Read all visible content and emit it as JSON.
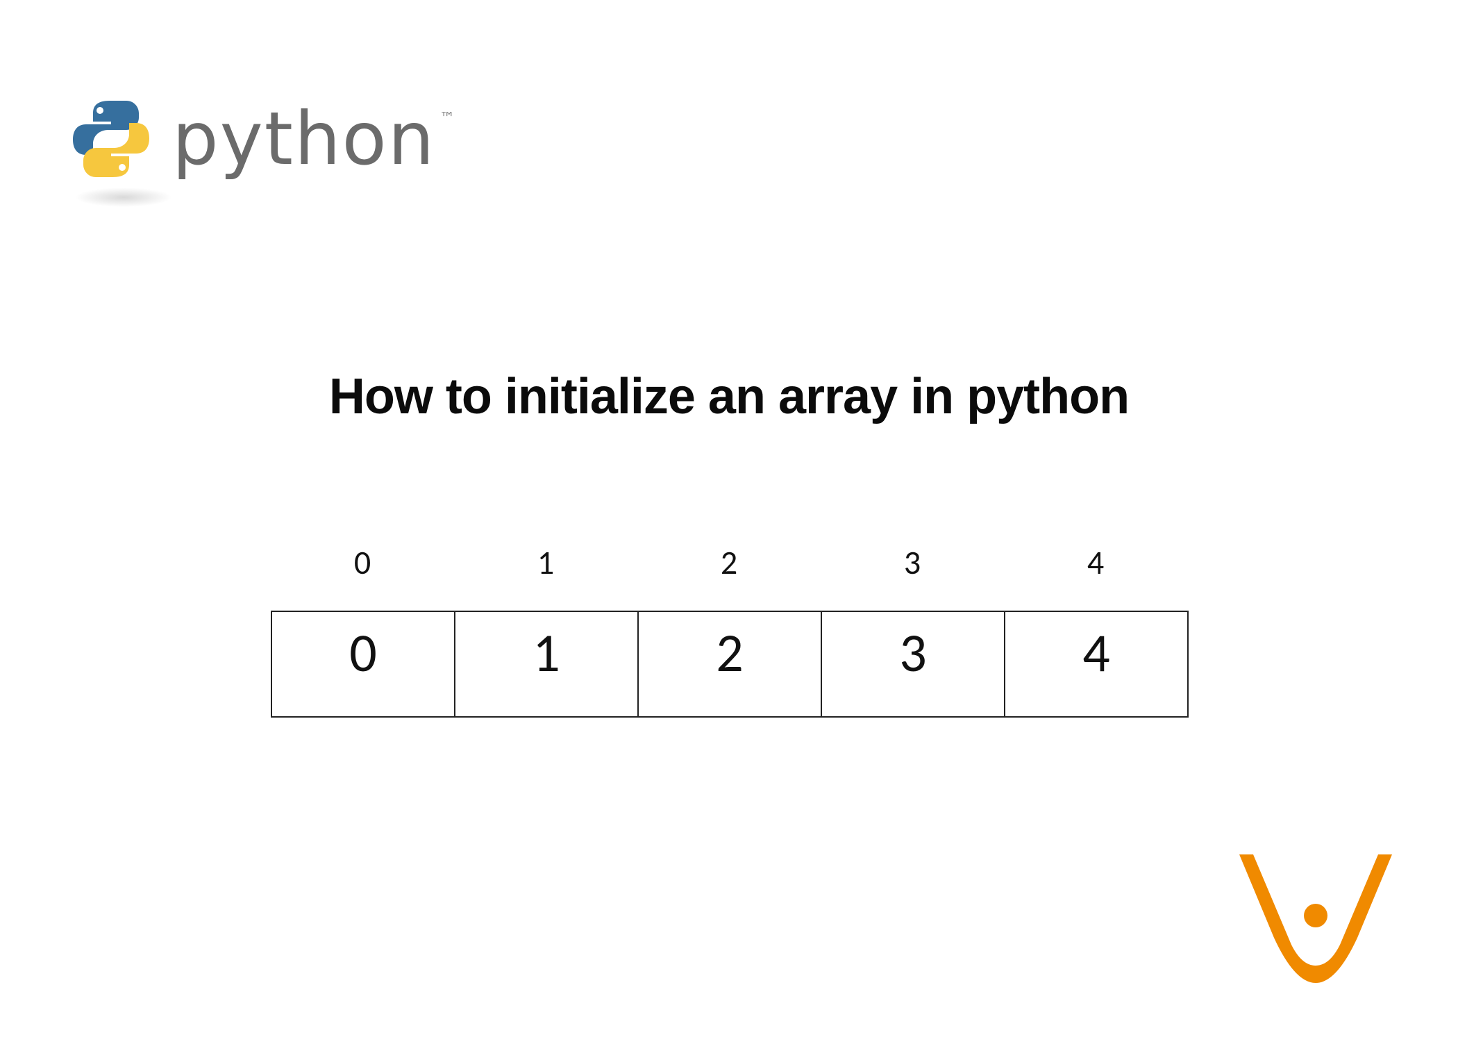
{
  "logo": {
    "word": "python",
    "trademark": "™"
  },
  "title": "How to initialize an array in python",
  "array": {
    "indices": [
      "0",
      "1",
      "2",
      "3",
      "4"
    ],
    "values": [
      "0",
      "1",
      "2",
      "3",
      "4"
    ]
  }
}
